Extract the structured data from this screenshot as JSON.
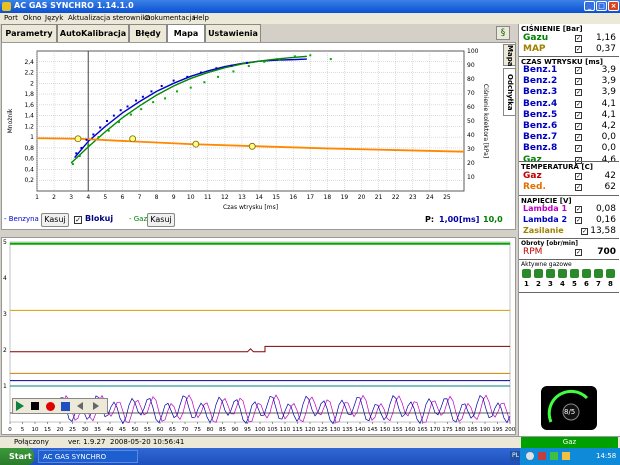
{
  "window": {
    "title": "AC GAS SYNCHRO   1.14.1.0"
  },
  "menu": [
    "Port",
    "Okno",
    "Język",
    "Aktualizacja sterownika",
    "Dokumentacja",
    "Help"
  ],
  "tabs": [
    {
      "label": "Parametry",
      "active": false
    },
    {
      "label": "AutoKalibracja",
      "active": false
    },
    {
      "label": "Błędy",
      "active": false
    },
    {
      "label": "Mapa",
      "active": true
    },
    {
      "label": "Ustawienia",
      "active": false
    }
  ],
  "side_tabs": {
    "mapa": "Mapa",
    "odchylka": "Odchyłka"
  },
  "controls": {
    "benzyna_label": "- Benzyna",
    "gaz_label": "- Gaz",
    "kasuj": "Kasuj",
    "blokuj": "Blokuj",
    "p_label": "P:",
    "p_value": "1,00",
    "p_unit": "[ms]",
    "p_value2": "10,0"
  },
  "right_panel": {
    "pressure_title": "CIŚNIENIE [Bar]",
    "pressure": [
      {
        "label": "Gazu",
        "value": "1,16",
        "color": "#008000"
      },
      {
        "label": "MAP",
        "value": "0,37",
        "color": "#a08000"
      }
    ],
    "injection_title": "CZAS WTRYSKU [ms]",
    "injection": [
      {
        "label": "Benz.1",
        "value": "3,9",
        "color": "#0000c0"
      },
      {
        "label": "Benz.2",
        "value": "3,9",
        "color": "#0000c0"
      },
      {
        "label": "Benz.3",
        "value": "3,9",
        "color": "#0000c0"
      },
      {
        "label": "Benz.4",
        "value": "4,1",
        "color": "#0000c0"
      },
      {
        "label": "Benz.5",
        "value": "4,1",
        "color": "#0000c0"
      },
      {
        "label": "Benz.6",
        "value": "4,2",
        "color": "#0000c0"
      },
      {
        "label": "Benz.7",
        "value": "0,0",
        "color": "#0000c0"
      },
      {
        "label": "Benz.8",
        "value": "0,0",
        "color": "#0000c0"
      },
      {
        "label": "Gaz",
        "value": "4,6",
        "color": "#008000"
      }
    ],
    "temp_title": "TEMPERATURA [C]",
    "temp": [
      {
        "label": "Gaz",
        "value": "42",
        "color": "#c00000"
      },
      {
        "label": "Red.",
        "value": "62",
        "color": "#e07000"
      }
    ],
    "voltage_title": "NAPIĘCIE [V]",
    "voltage": [
      {
        "label": "Lambda 1",
        "value": "0,08",
        "color": "#c000c0"
      },
      {
        "label": "Lambda 2",
        "value": "0,16",
        "color": "#0000c0"
      },
      {
        "label": "Zasilanie",
        "value": "13,58",
        "color": "#a08000"
      }
    ],
    "rpm_title": "Obroty [obr/min]",
    "rpm": {
      "label": "RPM",
      "value": "700",
      "color": "#c00000"
    },
    "injectors_title": "Aktywne gazowe",
    "injectors": [
      "1",
      "2",
      "3",
      "4",
      "5",
      "6",
      "7",
      "8"
    ],
    "gauge_value": "8/5",
    "gaz_status": "Gaz"
  },
  "status": {
    "port": "Połączony",
    "version": "ver. 1.9.27",
    "datetime": "2008-05-20  10:56:41"
  },
  "taskbar": {
    "start": "Start",
    "item": "AC GAS SYNCHRO",
    "lang": "PL",
    "clock": "14:58"
  },
  "chart_data": [
    {
      "type": "scatter",
      "title": "",
      "xlabel": "Czas wtrysku [ms]",
      "ylabel": "Mnożnik",
      "ylabel2": "Ciśnienie kolektora [kPa]",
      "xlim": [
        1,
        26
      ],
      "ylim": [
        0,
        2.6
      ],
      "y2lim": [
        0,
        100
      ],
      "xticks": [
        1,
        2,
        3,
        4,
        5,
        6,
        7,
        8,
        9,
        10,
        11,
        12,
        13,
        14,
        15,
        16,
        17,
        18,
        19,
        20,
        21,
        22,
        23,
        24,
        25
      ],
      "yticks": [
        "0,2",
        "0,4",
        "0,6",
        "0,8",
        "1",
        "1,2",
        "1,4",
        "1,6",
        "1,8",
        "2",
        "2,2",
        "2,4"
      ],
      "y2ticks": [
        10,
        20,
        30,
        40,
        50,
        60,
        70,
        80,
        90,
        100
      ],
      "grid": true,
      "series": [
        {
          "color": "#0000cc",
          "line_x": [
            3.2,
            4,
            5,
            6,
            7,
            8,
            9,
            10,
            11,
            12,
            13,
            14,
            15,
            16,
            16.8
          ],
          "line_y": [
            0.62,
            0.92,
            1.2,
            1.45,
            1.66,
            1.85,
            2.0,
            2.13,
            2.23,
            2.31,
            2.37,
            2.41,
            2.43,
            2.44,
            2.45
          ]
        },
        {
          "color": "#008800",
          "line_x": [
            3.0,
            4,
            5,
            6,
            7,
            8,
            9,
            10,
            11,
            12,
            13,
            14,
            15,
            16,
            16.8
          ],
          "line_y": [
            0.52,
            0.82,
            1.1,
            1.36,
            1.58,
            1.78,
            1.95,
            2.09,
            2.2,
            2.29,
            2.36,
            2.41,
            2.45,
            2.48,
            2.5
          ]
        },
        {
          "color": "#ff8800",
          "line_x": [
            1,
            3.5,
            6,
            10,
            14,
            18,
            22,
            26
          ],
          "line_y": [
            0.98,
            0.97,
            0.93,
            0.87,
            0.83,
            0.79,
            0.76,
            0.73
          ]
        }
      ],
      "points_blue_x": [
        3.3,
        3.6,
        3.9,
        4.3,
        4.7,
        5.1,
        5.5,
        5.9,
        6.3,
        6.8,
        7.2,
        7.7,
        8.3,
        9,
        9.8,
        10.6,
        11.5,
        12.4,
        13.3
      ],
      "points_blue_y": [
        0.7,
        0.8,
        0.95,
        1.05,
        1.18,
        1.3,
        1.4,
        1.5,
        1.57,
        1.68,
        1.75,
        1.85,
        1.95,
        2.05,
        2.12,
        2.2,
        2.28,
        2.33,
        2.38
      ],
      "points_green_x": [
        3.1,
        3.5,
        4,
        4.6,
        5.2,
        5.8,
        6.5,
        7.1,
        7.8,
        8.5,
        9.2,
        10,
        10.8,
        11.6,
        12.5,
        13.4,
        14.3,
        15.2,
        16.1,
        17,
        18.2
      ],
      "points_green_y": [
        0.5,
        0.65,
        0.85,
        1.0,
        1.12,
        1.28,
        1.42,
        1.52,
        1.65,
        1.72,
        1.85,
        1.92,
        2.02,
        2.12,
        2.22,
        2.32,
        2.4,
        2.44,
        2.5,
        2.52,
        2.45
      ],
      "orange_markers_x": [
        3.4,
        6.6,
        10.3,
        13.6
      ],
      "orange_markers_y": [
        0.97,
        0.97,
        0.87,
        0.83
      ]
    },
    {
      "type": "line",
      "title": "",
      "xlim": [
        0,
        200
      ],
      "ylim": [
        0,
        5
      ],
      "xticks": [
        0,
        5,
        10,
        15,
        20,
        25,
        30,
        35,
        40,
        45,
        50,
        55,
        60,
        65,
        70,
        75,
        80,
        85,
        90,
        95,
        100,
        105,
        110,
        115,
        120,
        125,
        130,
        135,
        140,
        145,
        150,
        155,
        160,
        165,
        170,
        175,
        180,
        185,
        190,
        195,
        200
      ],
      "yticks": [
        1,
        2,
        3,
        4,
        5
      ],
      "series": [
        {
          "color": "#00aa00",
          "y": [
            4.95
          ]
        },
        {
          "color": "#d0a000",
          "y": [
            3.1
          ]
        },
        {
          "color": "#800000",
          "y_start": 1.95,
          "y_end": 2.1
        },
        {
          "color": "#d08000",
          "y": [
            1.35
          ]
        },
        {
          "color": "#0000aa",
          "y": [
            1.15
          ]
        },
        {
          "color": "#008080",
          "y": [
            1.0
          ]
        }
      ]
    }
  ]
}
